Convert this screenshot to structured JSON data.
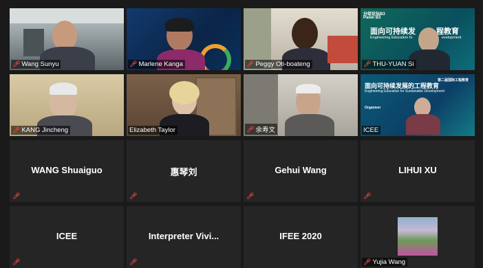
{
  "tiles": [
    {
      "name": "Wang Sunyu"
    },
    {
      "name": "Marlene Kanga"
    },
    {
      "name": "Peggy  Oti-boateng"
    },
    {
      "name": "THU-YUAN Si",
      "slide_tag": "分组论坛B3",
      "slide_panel": "Panel B3",
      "slide_title": "面向可持续发",
      "slide_title2": "程教育",
      "slide_sub": "Engineering Education fo",
      "slide_sub2": "evelopment"
    },
    {
      "name": "KANG Jincheng"
    },
    {
      "name": "Elizabeth Taylor"
    },
    {
      "name": "余寿文"
    },
    {
      "name": "ICEE",
      "slide_title": "面向可持续发展的工程教育",
      "slide_sub": "Engineering Education for Sustainable Development",
      "slide_org": "Organizer",
      "slide_corner": "第二届国际工程教育"
    },
    {
      "name": "WANG Shuaiguo"
    },
    {
      "name": "惠琴刘"
    },
    {
      "name": "Gehui Wang"
    },
    {
      "name": "LIHUI XU"
    },
    {
      "name": "ICEE"
    },
    {
      "name": "Interpreter  Vivi..."
    },
    {
      "name": "IFEE 2020"
    },
    {
      "name": "Yujia Wang"
    }
  ],
  "colors": {
    "mic_muted": "#e0423b",
    "active_border": "#e6e08a",
    "tile_bg": "#252525"
  }
}
